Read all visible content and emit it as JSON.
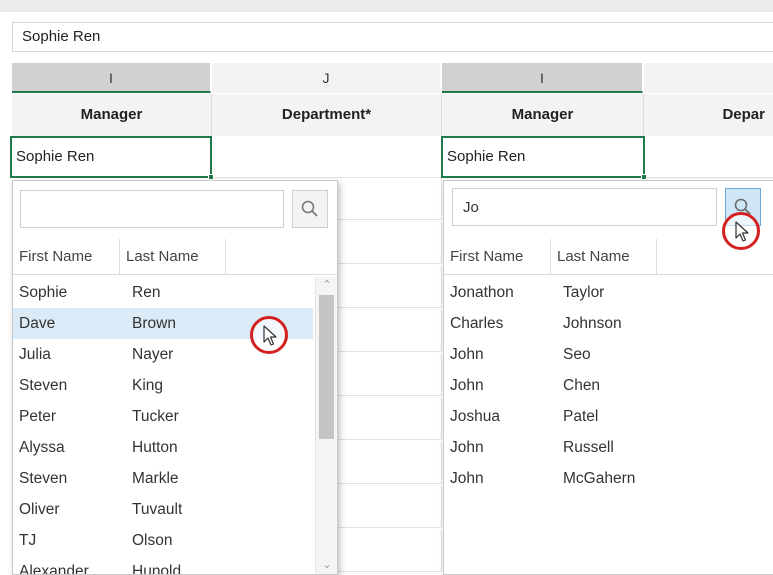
{
  "formula_bar": {
    "value": "Sophie Ren"
  },
  "columns": {
    "left_i": "I",
    "left_j": "J",
    "right_i": "I"
  },
  "field_headers": {
    "manager_left": "Manager",
    "department": "Department*",
    "manager_right": "Manager",
    "department_right": "Depar"
  },
  "active_cell": {
    "left": "Sophie Ren",
    "right": "Sophie Ren"
  },
  "left_dropdown": {
    "search_value": "",
    "headers": [
      "First Name",
      "Last Name"
    ],
    "rows": [
      {
        "first": "Sophie",
        "last": "Ren"
      },
      {
        "first": "Dave",
        "last": "Brown"
      },
      {
        "first": "Julia",
        "last": "Nayer"
      },
      {
        "first": "Steven",
        "last": "King"
      },
      {
        "first": "Peter",
        "last": "Tucker"
      },
      {
        "first": "Alyssa",
        "last": "Hutton"
      },
      {
        "first": "Steven",
        "last": "Markle"
      },
      {
        "first": "Oliver",
        "last": "Tuvault"
      },
      {
        "first": "TJ",
        "last": "Olson"
      },
      {
        "first": "Alexander",
        "last": "Hunold"
      }
    ],
    "hovered_row": "Dave"
  },
  "right_dropdown": {
    "search_value": "Jo",
    "headers": [
      "First Name",
      "Last Name"
    ],
    "rows": [
      {
        "first": "Jonathon",
        "last": "Taylor"
      },
      {
        "first": "Charles",
        "last": "Johnson"
      },
      {
        "first": "John",
        "last": "Seo"
      },
      {
        "first": "John",
        "last": "Chen"
      },
      {
        "first": "Joshua",
        "last": "Patel"
      },
      {
        "first": "John",
        "last": "Russell"
      },
      {
        "first": "John",
        "last": "McGahern"
      }
    ]
  },
  "icons": {
    "search": "search-icon",
    "cursor": "mouse-pointer-icon",
    "scroll_up": "chevron-up-icon",
    "scroll_down": "chevron-down-icon"
  },
  "colors": {
    "accent_green": "#1f7a4b",
    "highlight_blue": "#dbeaf7",
    "annotation_red": "#d32020"
  }
}
